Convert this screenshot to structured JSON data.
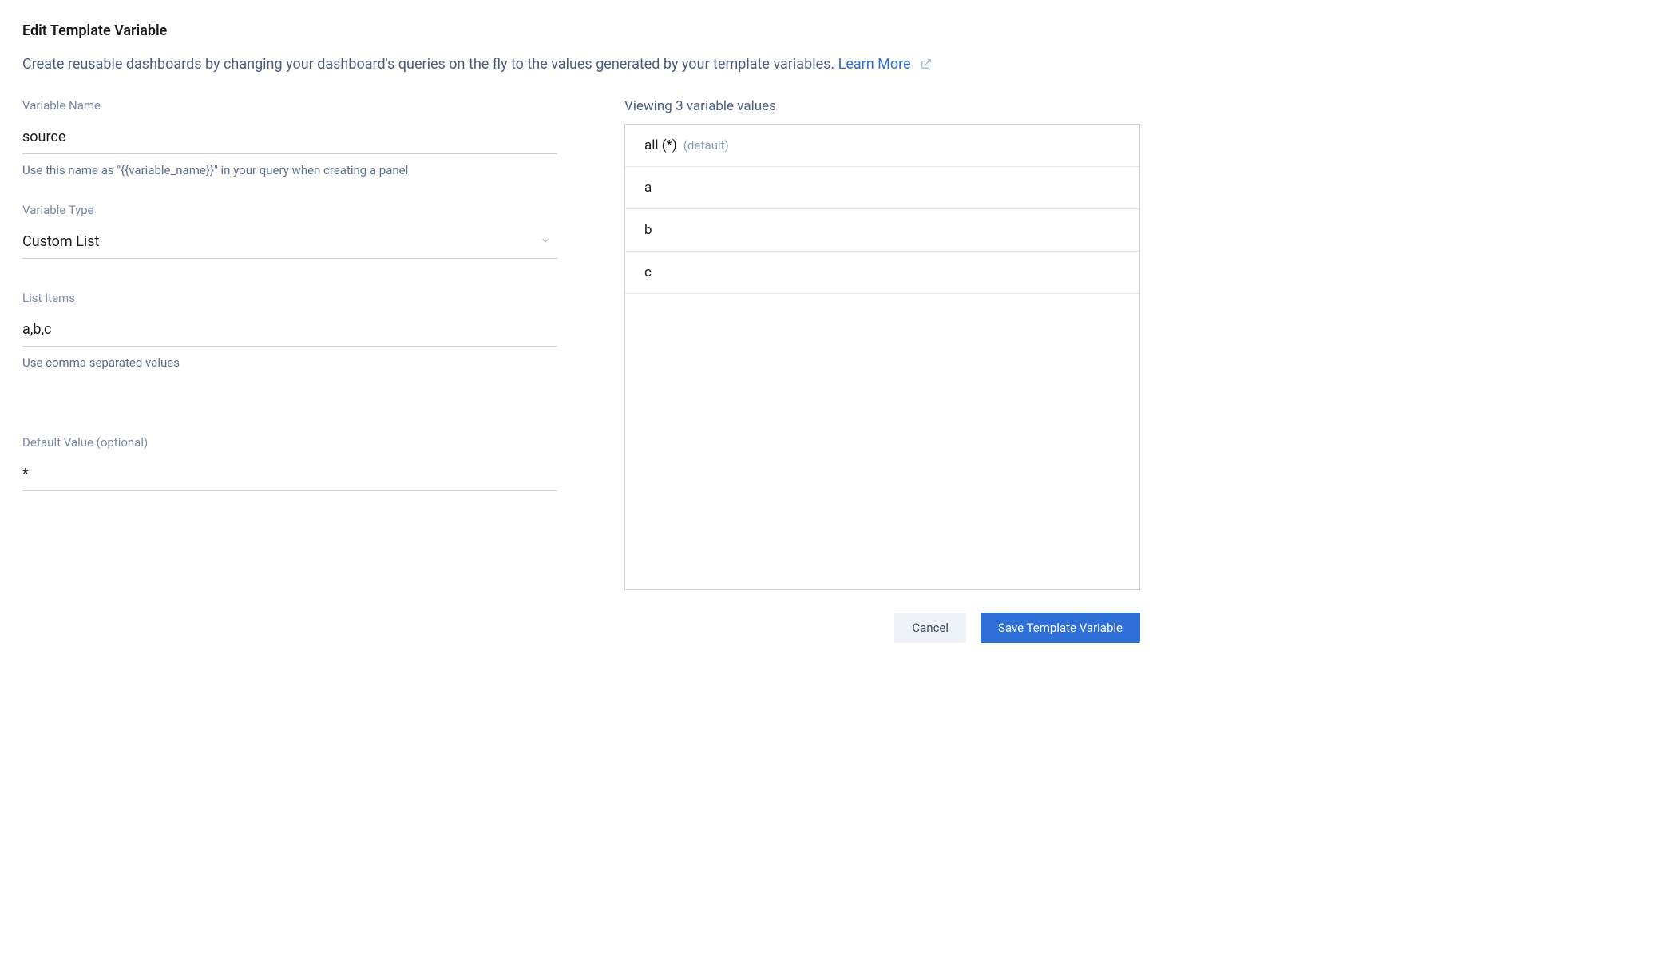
{
  "page": {
    "title": "Edit Template Variable",
    "description": "Create reusable dashboards by changing your dashboard's queries on the fly to the values generated by your template variables.",
    "learn_more_label": "Learn More"
  },
  "form": {
    "variable_name": {
      "label": "Variable Name",
      "value": "source",
      "hint": "Use this name as \"{{variable_name}}\" in your query when creating a panel"
    },
    "variable_type": {
      "label": "Variable Type",
      "value": "Custom List"
    },
    "list_items": {
      "label": "List Items",
      "value": "a,b,c",
      "hint": "Use comma separated values"
    },
    "default_value": {
      "label": "Default Value (optional)",
      "value": "*"
    }
  },
  "preview": {
    "title_prefix": "Viewing ",
    "count": "3",
    "title_suffix": " variable values",
    "default_tag": "(default)",
    "items": [
      {
        "label": "all (*)",
        "is_default": true
      },
      {
        "label": "a",
        "is_default": false
      },
      {
        "label": "b",
        "is_default": false
      },
      {
        "label": "c",
        "is_default": false
      }
    ]
  },
  "actions": {
    "cancel": "Cancel",
    "save": "Save Template Variable"
  }
}
